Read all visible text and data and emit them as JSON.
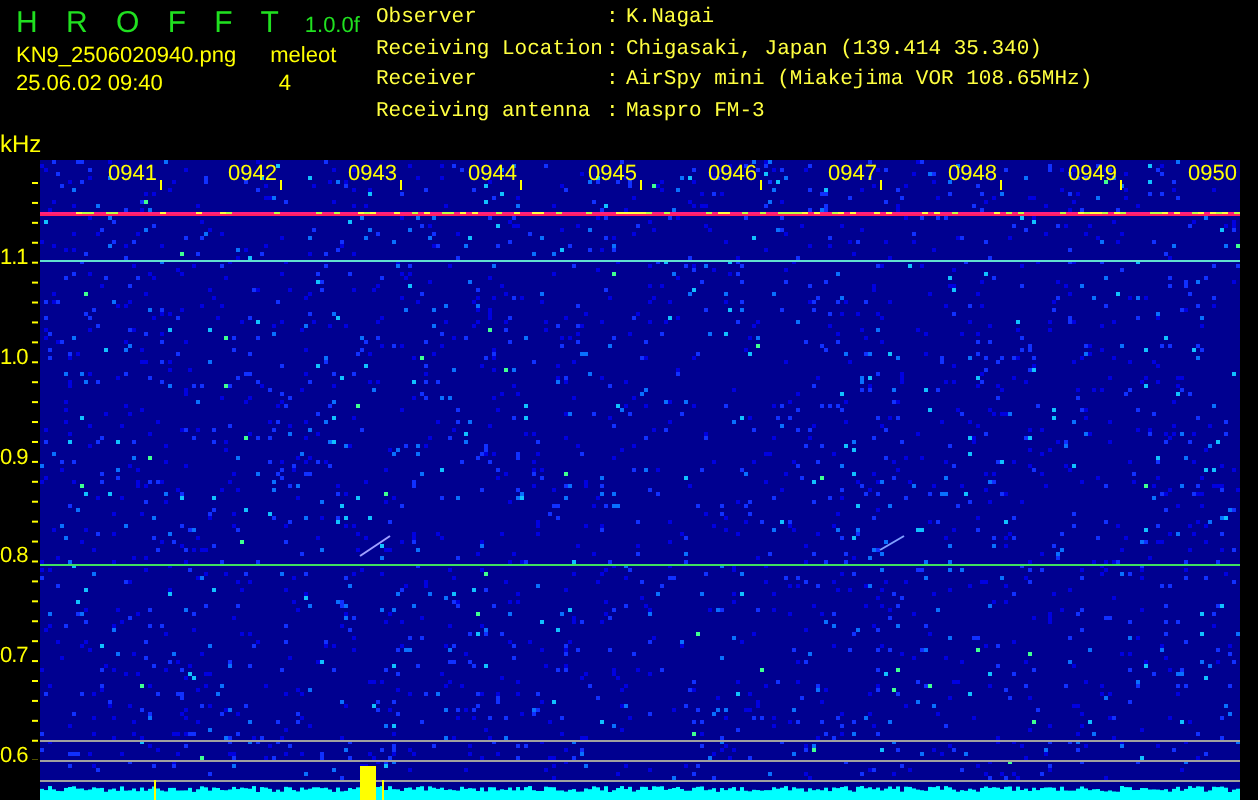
{
  "header": {
    "app_title": "H R O F F T",
    "version": "1.0.0f",
    "filename": "KN9_2506020940.png",
    "datetime": "25.06.02 09:40",
    "mode": "meleot",
    "count": "4"
  },
  "info": [
    {
      "label": "Observer",
      "separator": ":",
      "value": "K.Nagai"
    },
    {
      "label": "Receiving Location",
      "separator": ":",
      "value": "Chigasaki, Japan (139.414 35.340)"
    },
    {
      "label": "Receiver",
      "separator": ":",
      "value": "AirSpy mini (Miakejima VOR 108.65MHz)"
    },
    {
      "label": "Receiving antenna",
      "separator": ":",
      "value": "Maspro FM-3"
    }
  ],
  "spectrogram": {
    "unit": "kHz",
    "y_labels": [
      "1.1",
      "1.0",
      "0.9",
      "0.8",
      "0.7",
      "0.6"
    ],
    "time_labels": [
      "0941",
      "0942",
      "0943",
      "0944",
      "0945",
      "0946",
      "0947",
      "0948",
      "0949",
      "0950"
    ]
  }
}
